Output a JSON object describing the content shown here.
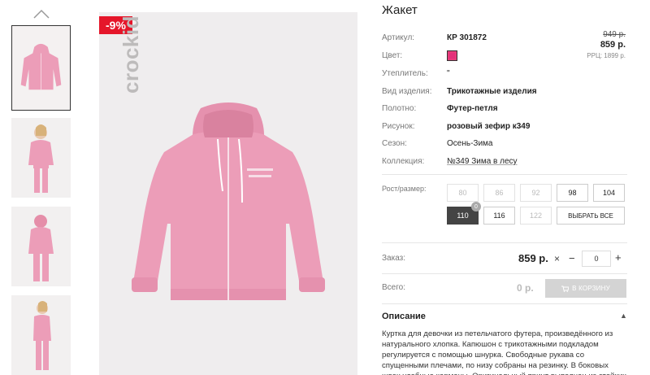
{
  "gallery": {
    "badge": "-9%",
    "brand": "crockid"
  },
  "product": {
    "title": "Жакет",
    "attributes": [
      {
        "key": "Артикул:",
        "value": "КР 301872",
        "bold": true
      },
      {
        "key": "Цвет:",
        "value": "",
        "swatch": "#e4307a"
      },
      {
        "key": "Утеплитель:",
        "value": "\"",
        "bold": false
      },
      {
        "key": "Вид изделия:",
        "value": "Трикотажные изделия",
        "bold": true
      },
      {
        "key": "Полотно:",
        "value": "Футер-петля",
        "bold": true
      },
      {
        "key": "Рисунок:",
        "value": "розовый зефир к349",
        "bold": true
      },
      {
        "key": "Сезон:",
        "value": "Осень-Зима",
        "bold": false
      },
      {
        "key": "Коллекция:",
        "value": "№349 Зима в лесу",
        "bold": false,
        "link": true
      }
    ],
    "price_old": "949 р.",
    "price_new": "859 р.",
    "price_rrp": "РРЦ: 1899 р."
  },
  "sizes": {
    "label": "Рост/размер:",
    "items": [
      {
        "label": "80",
        "state": "unavailable"
      },
      {
        "label": "86",
        "state": "unavailable"
      },
      {
        "label": "92",
        "state": "unavailable"
      },
      {
        "label": "98",
        "state": "available"
      },
      {
        "label": "104",
        "state": "available"
      },
      {
        "label": "110",
        "state": "active",
        "count": "0"
      },
      {
        "label": "116",
        "state": "available"
      },
      {
        "label": "122",
        "state": "unavailable"
      }
    ],
    "select_all": "ВЫБРАТЬ ВСЕ"
  },
  "order": {
    "label": "Заказ:",
    "price": "859 р.",
    "times": "×",
    "minus": "−",
    "qty": "0",
    "plus": "+"
  },
  "total": {
    "label": "Всего:",
    "price": "0 р.",
    "cart_button": "В КОРЗИНУ"
  },
  "description": {
    "title": "Описание",
    "text": "Куртка для девочки из петельчатого футера, произведённого из натурального хлопка. Капюшон с трикотажными подкладом регулируется с помощью шнурка. Свободные рукава со спущенными плечами, по низу собраны на резинку. В боковых швах удобные карманы. Оригинальный принт выполнен из стойких текстильных"
  },
  "colors": {
    "badge": "#e5162a",
    "jacket": "#ec9db8",
    "active_size": "#444444"
  }
}
